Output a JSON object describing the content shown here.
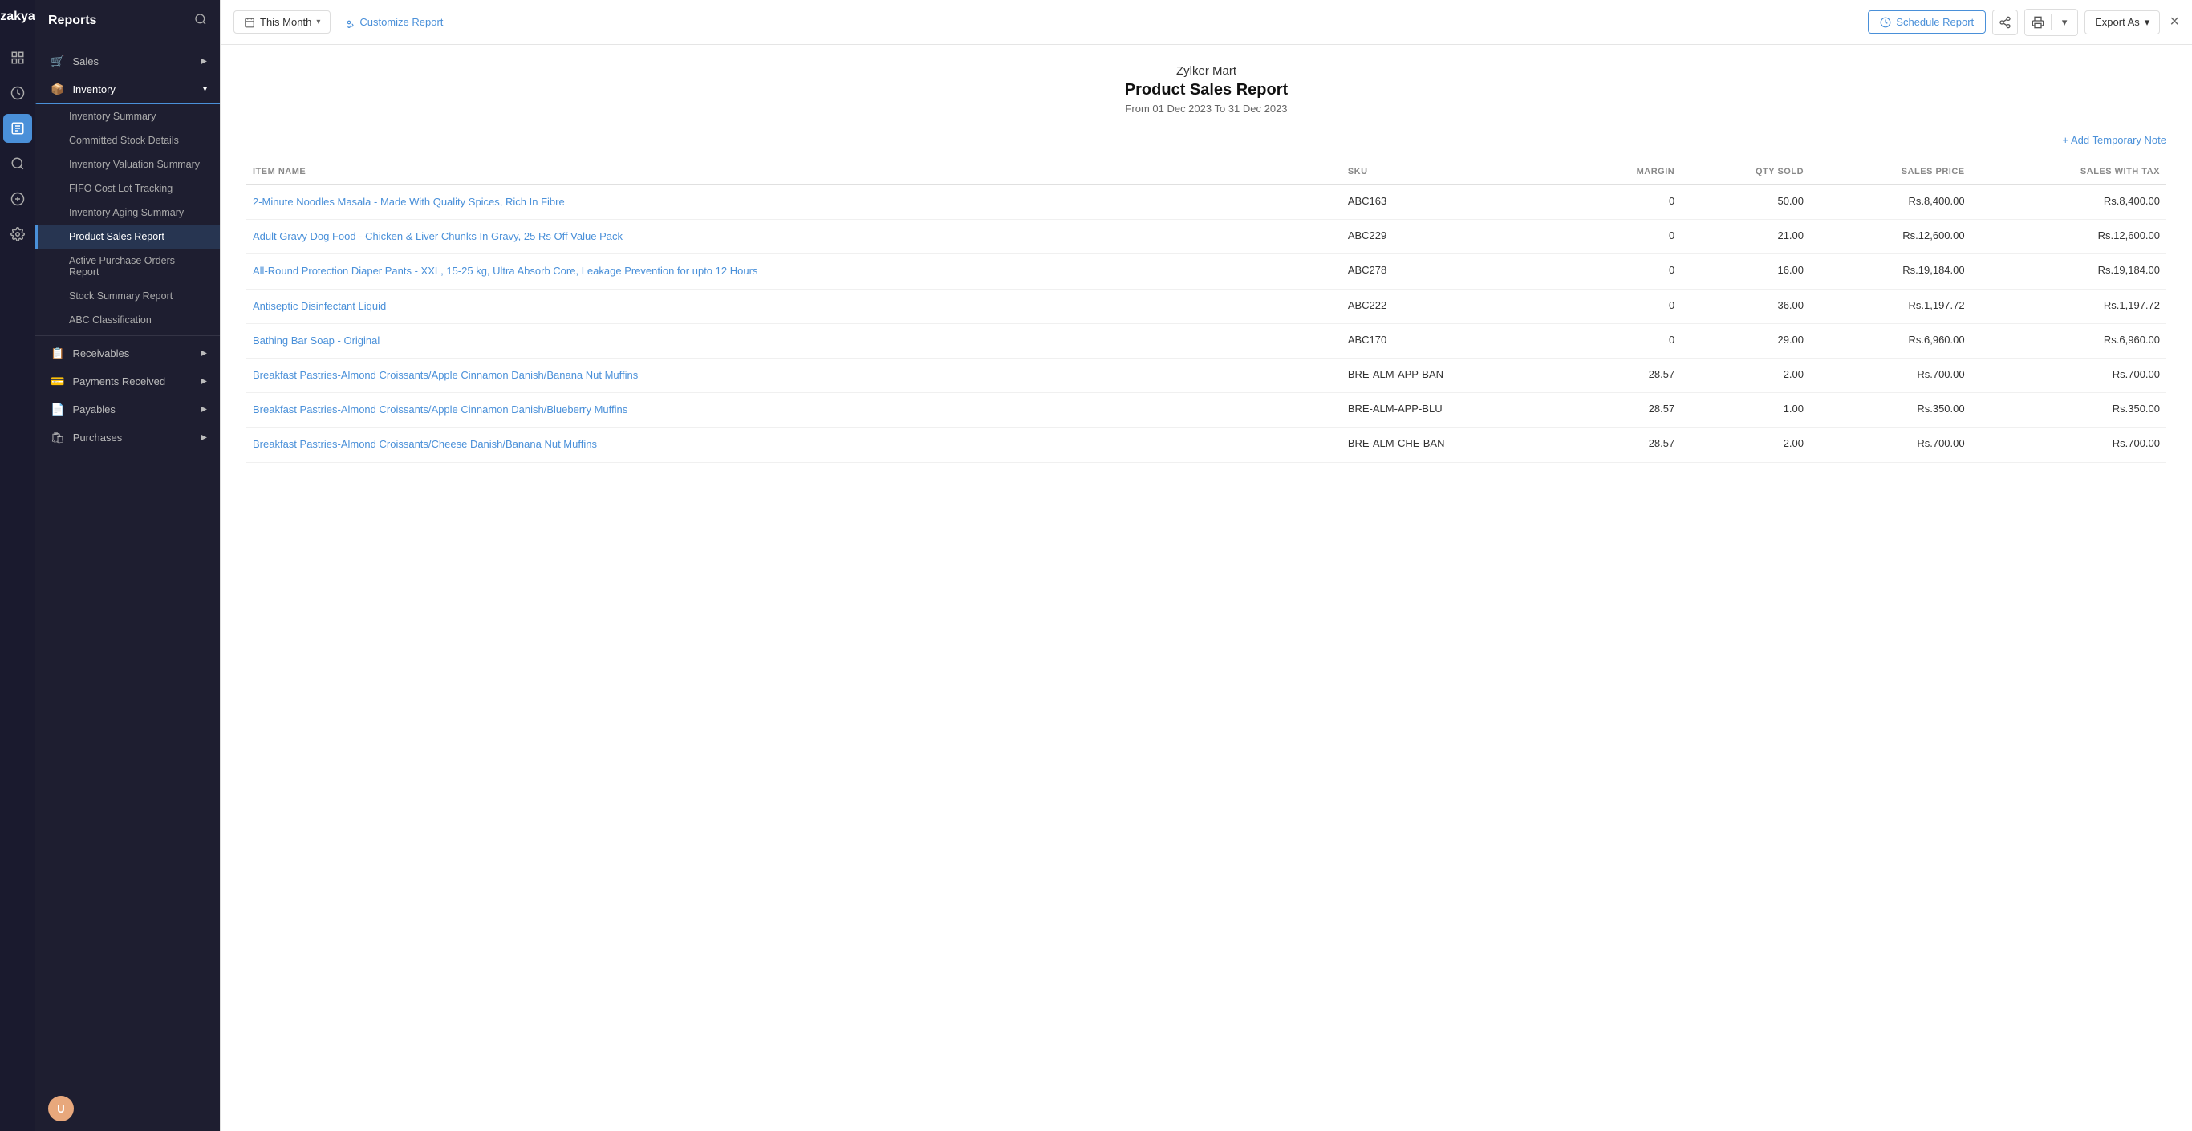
{
  "app": {
    "logo": "zakya",
    "title": "Reports"
  },
  "toolbar": {
    "date_label": "This Month",
    "customize_label": "Customize Report",
    "schedule_label": "Schedule Report",
    "export_label": "Export As",
    "add_note_label": "+ Add Temporary Note"
  },
  "report": {
    "company": "Zylker Mart",
    "name": "Product Sales Report",
    "date_range": "From 01 Dec 2023 To 31 Dec 2023"
  },
  "sidebar": {
    "title": "Reports",
    "nav_items": [
      {
        "id": "sales",
        "label": "Sales",
        "icon": "🛒",
        "has_arrow": true
      },
      {
        "id": "inventory",
        "label": "Inventory",
        "icon": "📦",
        "has_arrow": true,
        "expanded": true
      },
      {
        "id": "receivables",
        "label": "Receivables",
        "icon": "📋",
        "has_arrow": true
      },
      {
        "id": "payments",
        "label": "Payments Received",
        "icon": "💳",
        "has_arrow": true
      },
      {
        "id": "payables",
        "label": "Payables",
        "icon": "📄",
        "has_arrow": true
      },
      {
        "id": "purchases",
        "label": "Purchases",
        "icon": "🛍",
        "has_arrow": true
      }
    ],
    "inventory_sub_items": [
      {
        "id": "inventory-summary",
        "label": "Inventory Summary",
        "active": false
      },
      {
        "id": "committed-stock",
        "label": "Committed Stock Details",
        "active": false
      },
      {
        "id": "inv-valuation",
        "label": "Inventory Valuation Summary",
        "active": false
      },
      {
        "id": "fifo-cost",
        "label": "FIFO Cost Lot Tracking",
        "active": false
      },
      {
        "id": "inv-aging",
        "label": "Inventory Aging Summary",
        "active": false
      },
      {
        "id": "product-sales",
        "label": "Product Sales Report",
        "active": true
      },
      {
        "id": "active-po",
        "label": "Active Purchase Orders Report",
        "active": false
      },
      {
        "id": "stock-summary",
        "label": "Stock Summary Report",
        "active": false
      },
      {
        "id": "abc-class",
        "label": "ABC Classification",
        "active": false
      }
    ]
  },
  "table": {
    "columns": [
      "ITEM NAME",
      "SKU",
      "MARGIN",
      "QTY SOLD",
      "SALES PRICE",
      "SALES WITH TAX"
    ],
    "rows": [
      {
        "item_name": "2-Minute Noodles Masala - Made With Quality Spices, Rich In Fibre",
        "sku": "ABC163",
        "margin": "0",
        "qty_sold": "50.00",
        "sales_price": "Rs.8,400.00",
        "sales_with_tax": "Rs.8,400.00"
      },
      {
        "item_name": "Adult Gravy Dog Food - Chicken & Liver Chunks In Gravy, 25 Rs Off Value Pack",
        "sku": "ABC229",
        "margin": "0",
        "qty_sold": "21.00",
        "sales_price": "Rs.12,600.00",
        "sales_with_tax": "Rs.12,600.00"
      },
      {
        "item_name": "All-Round Protection Diaper Pants - XXL, 15-25 kg, Ultra Absorb Core, Leakage Prevention for upto 12 Hours",
        "sku": "ABC278",
        "margin": "0",
        "qty_sold": "16.00",
        "sales_price": "Rs.19,184.00",
        "sales_with_tax": "Rs.19,184.00"
      },
      {
        "item_name": "Antiseptic Disinfectant Liquid",
        "sku": "ABC222",
        "margin": "0",
        "qty_sold": "36.00",
        "sales_price": "Rs.1,197.72",
        "sales_with_tax": "Rs.1,197.72"
      },
      {
        "item_name": "Bathing Bar Soap - Original",
        "sku": "ABC170",
        "margin": "0",
        "qty_sold": "29.00",
        "sales_price": "Rs.6,960.00",
        "sales_with_tax": "Rs.6,960.00"
      },
      {
        "item_name": "Breakfast Pastries-Almond Croissants/Apple Cinnamon Danish/Banana Nut Muffins",
        "sku": "BRE-ALM-APP-BAN",
        "margin": "28.57",
        "qty_sold": "2.00",
        "sales_price": "Rs.700.00",
        "sales_with_tax": "Rs.700.00"
      },
      {
        "item_name": "Breakfast Pastries-Almond Croissants/Apple Cinnamon Danish/Blueberry Muffins",
        "sku": "BRE-ALM-APP-BLU",
        "margin": "28.57",
        "qty_sold": "1.00",
        "sales_price": "Rs.350.00",
        "sales_with_tax": "Rs.350.00"
      },
      {
        "item_name": "Breakfast Pastries-Almond Croissants/Cheese Danish/Banana Nut Muffins",
        "sku": "BRE-ALM-CHE-BAN",
        "margin": "28.57",
        "qty_sold": "2.00",
        "sales_price": "Rs.700.00",
        "sales_with_tax": "Rs.700.00"
      }
    ]
  }
}
